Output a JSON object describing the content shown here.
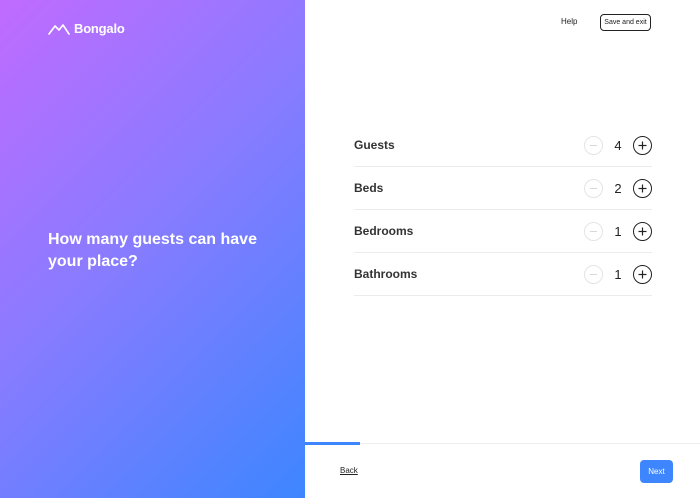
{
  "brand": {
    "name": "Bongalo",
    "icon": "house-outline-icon"
  },
  "headline": "How many guests can have your place?",
  "header": {
    "help_label": "Help",
    "save_exit_label": "Save and exit"
  },
  "counters": [
    {
      "label": "Guests",
      "value": "4"
    },
    {
      "label": "Beds",
      "value": "2"
    },
    {
      "label": "Bedrooms",
      "value": "1"
    },
    {
      "label": "Bathrooms",
      "value": "1"
    }
  ],
  "progress": {
    "fraction": 0.14
  },
  "footer": {
    "back_label": "Back",
    "next_label": "Next"
  },
  "colors": {
    "gradient_start": "#c06bff",
    "gradient_end": "#3d86ff",
    "accent": "#3d86ff"
  }
}
